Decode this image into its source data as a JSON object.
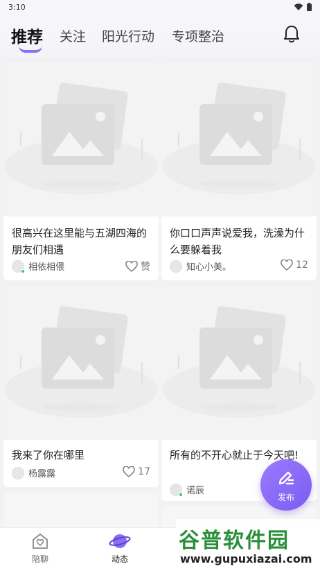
{
  "status_bar": {
    "time": "3:10"
  },
  "tabs": [
    {
      "label": "推荐",
      "active": true
    },
    {
      "label": "关注",
      "active": false
    },
    {
      "label": "阳光行动",
      "active": false
    },
    {
      "label": "专项整治",
      "active": false
    }
  ],
  "cards": [
    {
      "title": "很高兴在这里能与五湖四海的朋友们相遇",
      "author": "相依相偎",
      "online": true,
      "like": "赞"
    },
    {
      "title": "你口口声声说爱我，洗澡为什么要躲着我",
      "author": "知心小美。",
      "online": false,
      "like": "12"
    },
    {
      "title": "我来了你在哪里",
      "author": "杨露露",
      "online": false,
      "like": "17"
    },
    {
      "title": "所有的不开心就止于今天吧!",
      "author": "诺辰",
      "online": true,
      "like": ""
    }
  ],
  "publish_button": {
    "label": "发布"
  },
  "bottom_nav": [
    {
      "label": "陪聊",
      "icon": "home-heart-icon",
      "active": false
    },
    {
      "label": "动态",
      "icon": "planet-icon",
      "active": true
    }
  ],
  "watermark": {
    "main": "谷普软件园",
    "sub": "www.gupuxiazai.com"
  },
  "colors": {
    "accent": "#8d6df2",
    "online": "#2fd158",
    "watermark_green": "#2a8f3a"
  }
}
